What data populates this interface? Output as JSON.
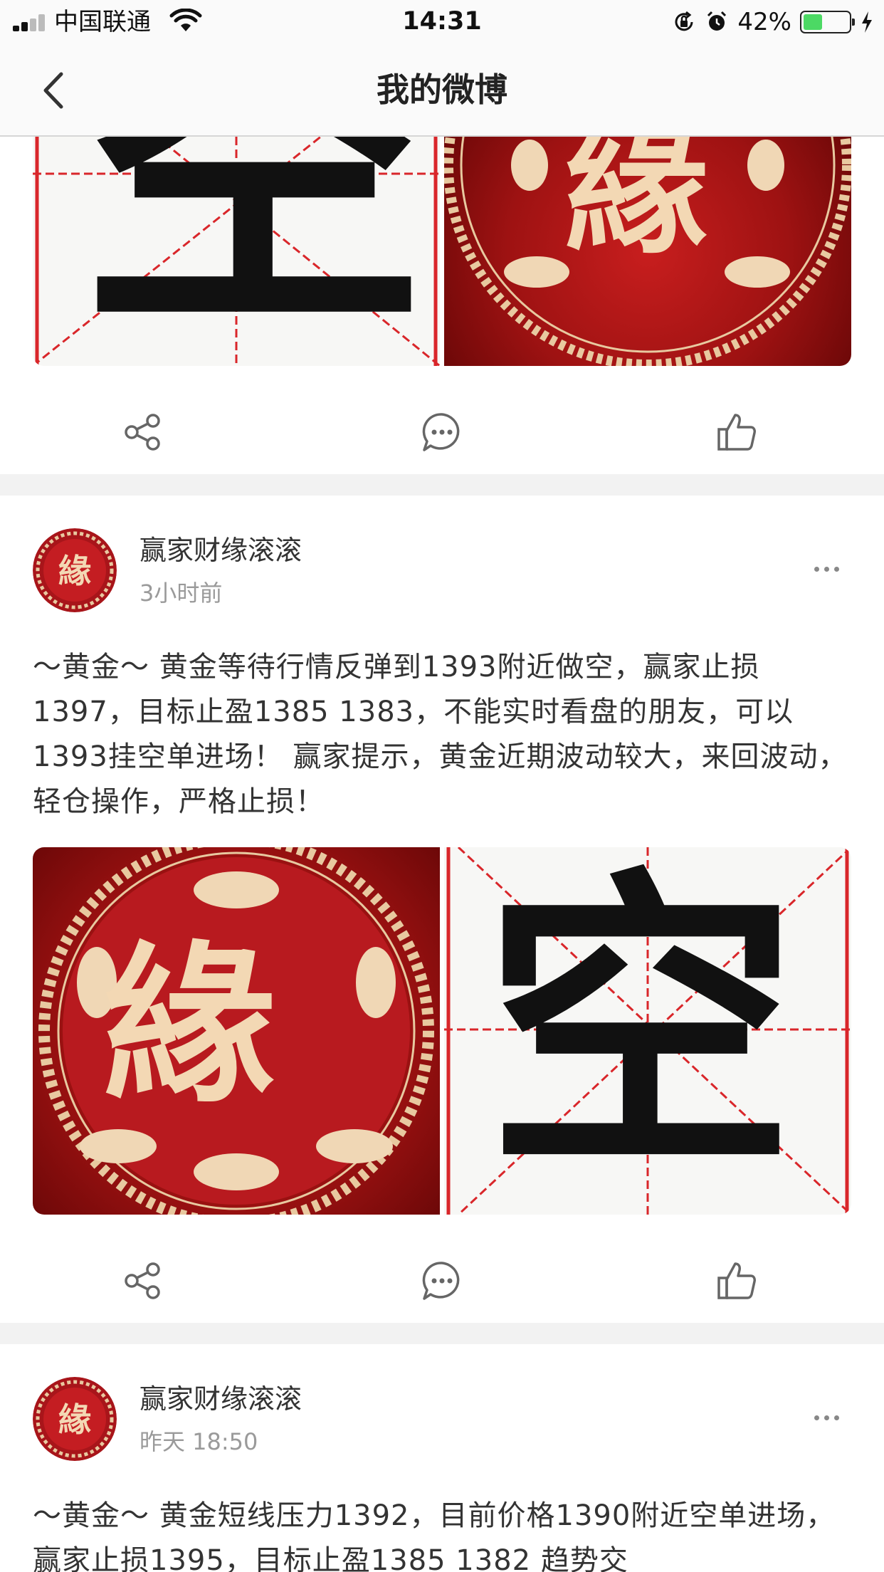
{
  "status_bar": {
    "carrier": "中国联通",
    "time": "14:31",
    "battery_percent": "42%",
    "battery_level": 0.42,
    "icons": [
      "signal-icon",
      "wifi-icon",
      "orientation-lock-icon",
      "alarm-icon",
      "battery-icon",
      "charging-icon"
    ]
  },
  "nav": {
    "title": "我的微博",
    "back_icon": "chevron-left-icon"
  },
  "images": {
    "kong_char": "空",
    "yuan_char": "緣"
  },
  "posts": [
    {
      "author": "赢家财缘滚滚",
      "time": "3小时前",
      "text": "～黄金～ 黄金等待行情反弹到1393附近做空，赢家止损1397，目标止盈1385 1383，不能实时看盘的朋友，可以1393挂空单进场！ 赢家提示，黄金近期波动较大，来回波动，轻仓操作，严格止损！"
    },
    {
      "author": "赢家财缘滚滚",
      "time": "昨天 18:50",
      "text": "～黄金～ 黄金短线压力1392，目前价格1390附近空单进场，赢家止损1395，目标止盈1385 1382 趋势交"
    }
  ],
  "actions": {
    "icons": [
      "share-icon",
      "comment-icon",
      "like-icon"
    ]
  },
  "colors": {
    "accent_red": "#b5161b",
    "battery_green": "#4cd964",
    "separator": "#f2f2f2",
    "text_secondary": "#9a9a9a"
  }
}
